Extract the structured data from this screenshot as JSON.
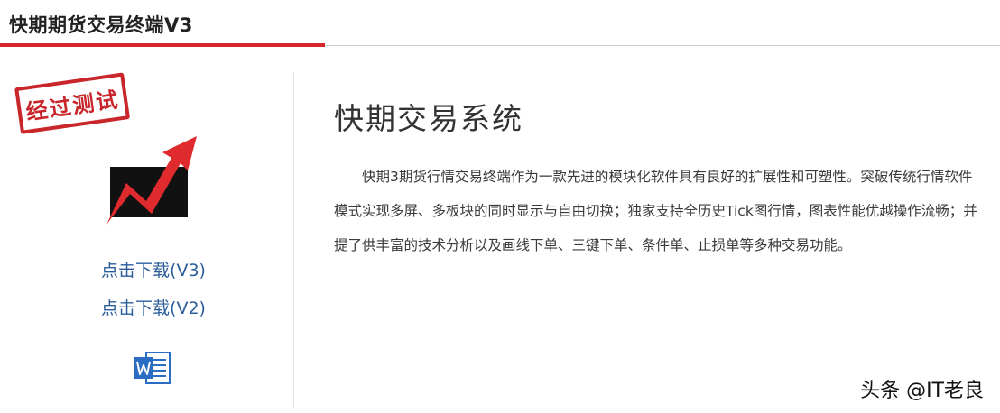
{
  "header": {
    "title": "快期期货交易终端V3"
  },
  "sidebar": {
    "stamp_text": "经过测试",
    "download_v3": "点击下载(V3)",
    "download_v2": "点击下载(V2)"
  },
  "main": {
    "title": "快期交易系统",
    "description": "快期3期货行情交易终端作为一款先进的模块化软件具有良好的扩展性和可塑性。突破传统行情软件模式实现多屏、多板块的同时显示与自由切换；独家支持全历史Tick图行情，图表性能优越操作流畅；并提了供丰富的技术分析以及画线下单、三键下单、条件单、止损单等多种交易功能。"
  },
  "watermark": {
    "text": "头条 @IT老良"
  },
  "colors": {
    "accent_red": "#d6262a",
    "link_blue": "#2a5c9a",
    "word_blue": "#2b6cc4"
  },
  "icons": [
    "approved-stamp",
    "rising-chart-arrow-icon",
    "word-document-icon"
  ]
}
